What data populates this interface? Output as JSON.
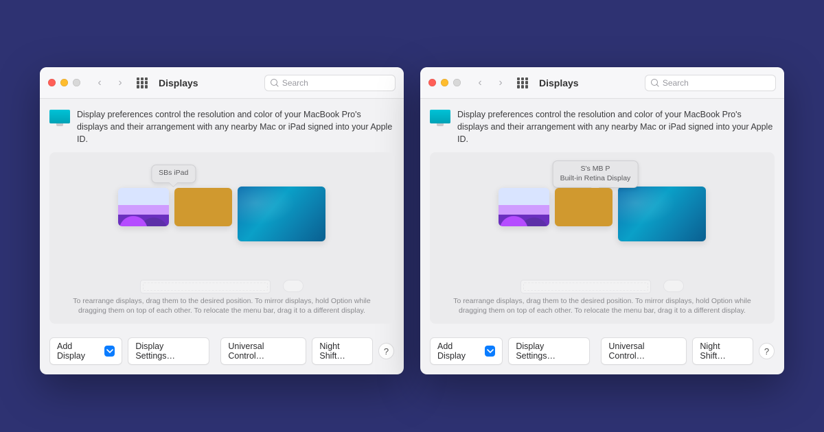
{
  "window_title": "Displays",
  "search_placeholder": "Search",
  "description": "Display preferences control the resolution and color of your MacBook Pro's displays and their arrangement with any nearby Mac or iPad signed into your Apple ID.",
  "hint": "To rearrange displays, drag them to the desired position. To mirror displays, hold Option while dragging them on top of each other. To relocate the menu bar, drag it to a different display.",
  "buttons": {
    "add_display": "Add Display",
    "display_settings": "Display Settings…",
    "universal_control": "Universal Control…",
    "night_shift": "Night Shift…",
    "help": "?"
  },
  "panels": [
    {
      "tooltip_lines": [
        "SBs iPad"
      ],
      "tooltip_target": 1,
      "tooltip_left_pct": 36
    },
    {
      "tooltip_lines": [
        "S's MB P",
        "Built-in Retina Display"
      ],
      "tooltip_target": 2,
      "tooltip_left_pct": 48
    }
  ]
}
